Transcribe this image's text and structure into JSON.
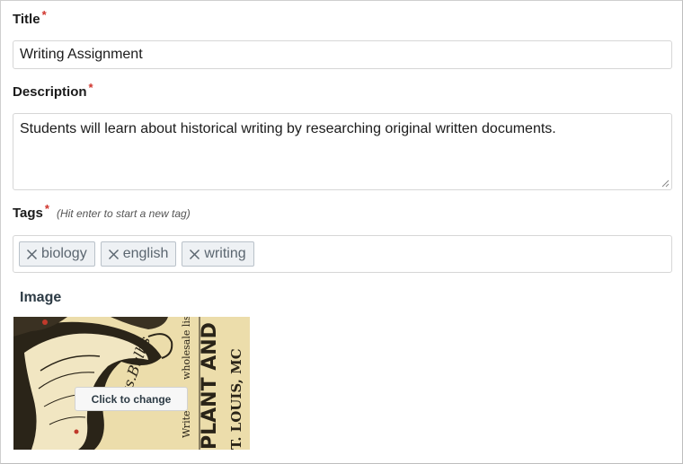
{
  "form": {
    "title": {
      "label": "Title",
      "required_mark": "*",
      "value": "Writing Assignment"
    },
    "description": {
      "label": "Description",
      "required_mark": "*",
      "value": "Students will learn about historical writing by researching original written documents."
    },
    "tags": {
      "label": "Tags",
      "required_mark": "*",
      "hint": "(Hit enter to start a new tag)",
      "items": [
        {
          "label": "biology",
          "remove_icon": "close-icon"
        },
        {
          "label": "english",
          "remove_icon": "close-icon"
        },
        {
          "label": "writing",
          "remove_icon": "close-icon"
        }
      ]
    },
    "image": {
      "label": "Image",
      "change_button": "Click to change",
      "printed_text": [
        "wholesale list.",
        "PLANT AND BU",
        "T. LOUIS, MC",
        "Write"
      ]
    }
  },
  "colors": {
    "required": "#d0342c",
    "tag_background": "#eef1f4",
    "tag_border": "#b9c1c9",
    "tag_text": "#5b6670",
    "field_border": "#d6d6d6",
    "image_paper": "#efe2b4"
  }
}
